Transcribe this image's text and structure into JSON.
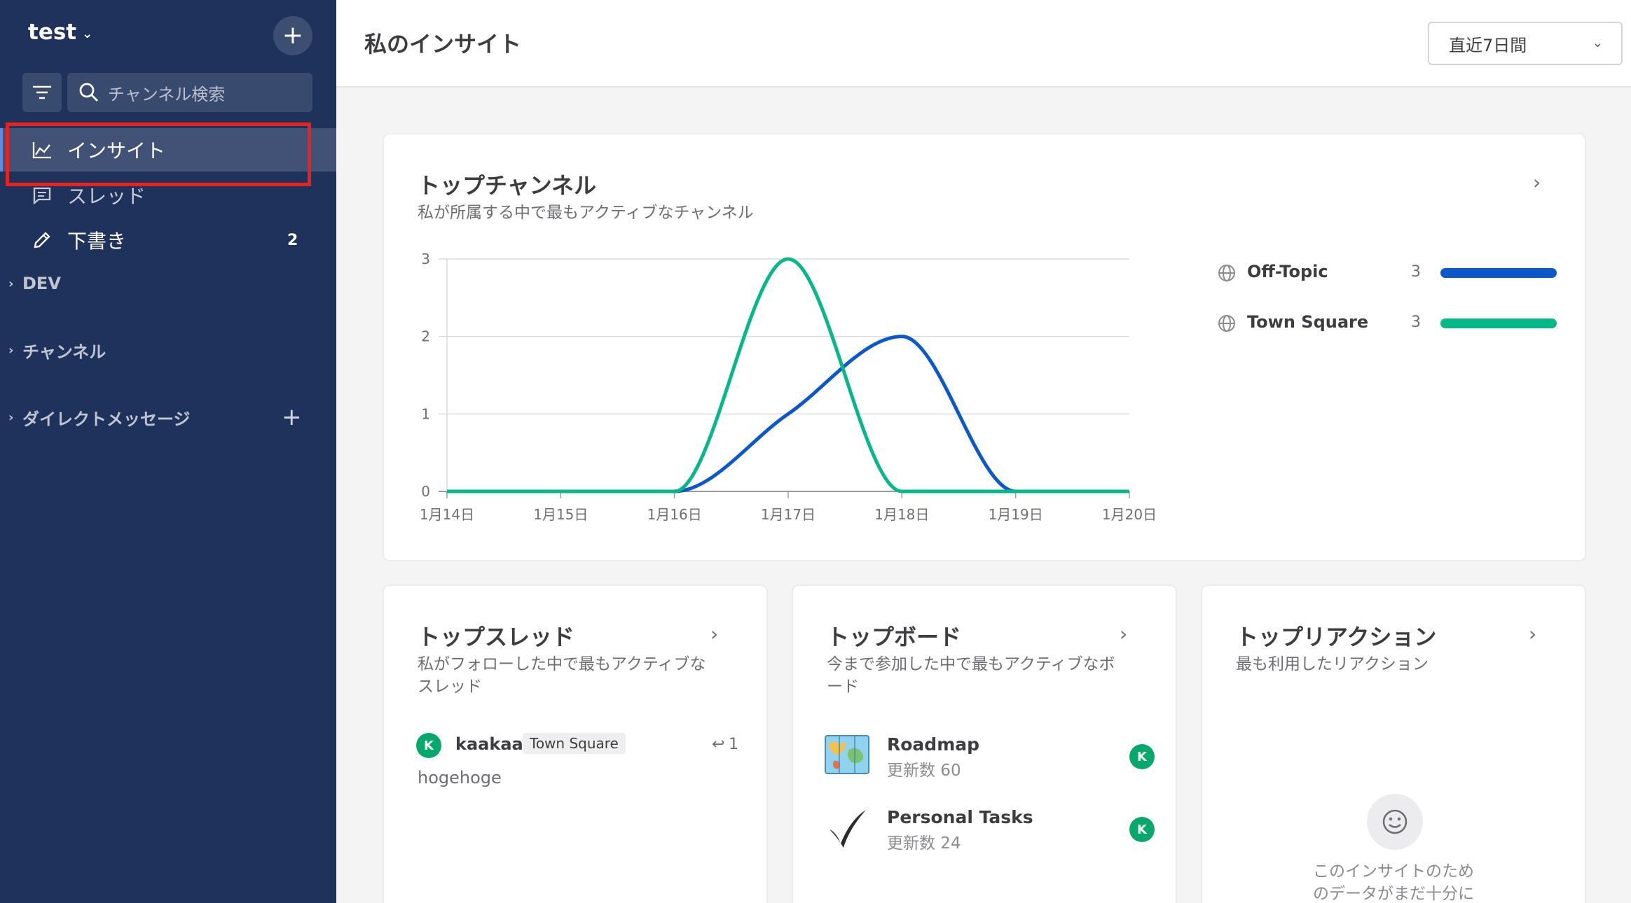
{
  "sidebar": {
    "team_name": "test",
    "search_placeholder": "チャンネル検索",
    "nav": {
      "insights": "インサイト",
      "threads": "スレッド",
      "drafts": "下書き",
      "drafts_count": "2"
    },
    "categories": {
      "dev": "DEV",
      "channels": "チャンネル",
      "direct_messages": "ダイレクトメッセージ"
    }
  },
  "header": {
    "title": "私のインサイト",
    "time_range": "直近7日間"
  },
  "top_channels": {
    "title": "トップチャンネル",
    "subtitle": "私が所属する中で最もアクティブなチャンネル",
    "legend": [
      {
        "name": "Off-Topic",
        "count": "3",
        "color": "#0a58ca"
      },
      {
        "name": "Town Square",
        "count": "3",
        "color": "#06b888"
      }
    ]
  },
  "chart_data": {
    "type": "line",
    "x": [
      "1月14日",
      "1月15日",
      "1月16日",
      "1月17日",
      "1月18日",
      "1月19日",
      "1月20日"
    ],
    "yticks": [
      "0",
      "1",
      "2",
      "3"
    ],
    "ylim": [
      0,
      3
    ],
    "grid": true,
    "series": [
      {
        "name": "Off-Topic",
        "values": [
          0,
          0,
          0,
          1,
          2,
          0,
          0
        ],
        "color": "#0a58ca"
      },
      {
        "name": "Town Square",
        "values": [
          0,
          0,
          0,
          3,
          0,
          0,
          0
        ],
        "color": "#06b888"
      }
    ]
  },
  "top_threads": {
    "title": "トップスレッド",
    "subtitle_line1": "私がフォローした中で最もアクティブな",
    "subtitle_line2": "スレッド",
    "items": [
      {
        "avatar": "K",
        "user": "kaakaa",
        "channel": "Town Square",
        "replies": "1",
        "message": "hogehoge"
      }
    ]
  },
  "top_boards": {
    "title": "トップボード",
    "subtitle_line1": "今まで参加した中で最もアクティブなボ",
    "subtitle_line2": "ード",
    "items": [
      {
        "name": "Roadmap",
        "meta": "更新数 60",
        "avatar": "K",
        "icon": "map-icon"
      },
      {
        "name": "Personal Tasks",
        "meta": "更新数 24",
        "avatar": "K",
        "icon": "checkmark-icon"
      }
    ]
  },
  "top_reactions": {
    "title": "トップリアクション",
    "subtitle": "最も利用したリアクション",
    "empty_line1": "このインサイトのため",
    "empty_line2": "のデータがまだ十分に"
  }
}
